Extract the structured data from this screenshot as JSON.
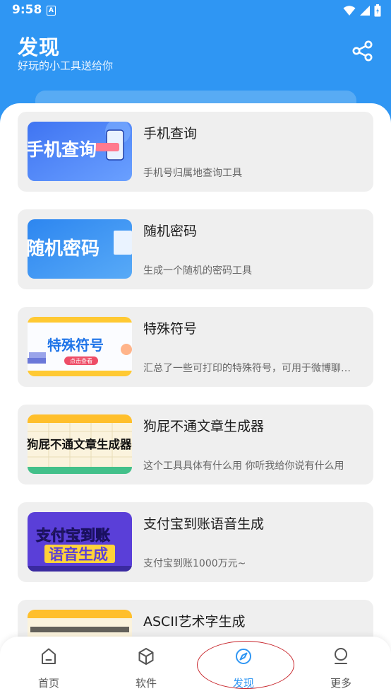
{
  "status_bar": {
    "time": "9:58",
    "notification_glyph": "A"
  },
  "header": {
    "title": "发现",
    "subtitle": "好玩的小工具送给你",
    "share_icon": "share-icon"
  },
  "tools": [
    {
      "title": "手机查询",
      "desc": "手机号归属地查询工具",
      "thumb_text": "手机查询"
    },
    {
      "title": "随机密码",
      "desc": "生成一个随机的密码工具",
      "thumb_text": "随机密码"
    },
    {
      "title": "特殊符号",
      "desc": "汇总了一些可打印的特殊符号，可用于微博聊…",
      "thumb_text": "特殊符号",
      "thumb_sub": "点击查看"
    },
    {
      "title": "狗屁不通文章生成器",
      "desc": "这个工具具体有什么用 你听我给你说有什么用",
      "thumb_text": "狗屁不通文章生成器"
    },
    {
      "title": "支付宝到账语音生成",
      "desc": "支付宝到账1000万元~",
      "thumb_text1": "支付宝到账",
      "thumb_text2": "语音生成"
    },
    {
      "title": "ASCII艺术字生成",
      "desc": ""
    }
  ],
  "nav": [
    {
      "label": "首页",
      "icon": "home-icon"
    },
    {
      "label": "软件",
      "icon": "cube-icon"
    },
    {
      "label": "发现",
      "icon": "compass-icon",
      "active": true
    },
    {
      "label": "更多",
      "icon": "person-icon"
    }
  ],
  "colors": {
    "primary": "#2f96f3",
    "card_bg": "#efefef",
    "highlight": "#c8262c"
  }
}
